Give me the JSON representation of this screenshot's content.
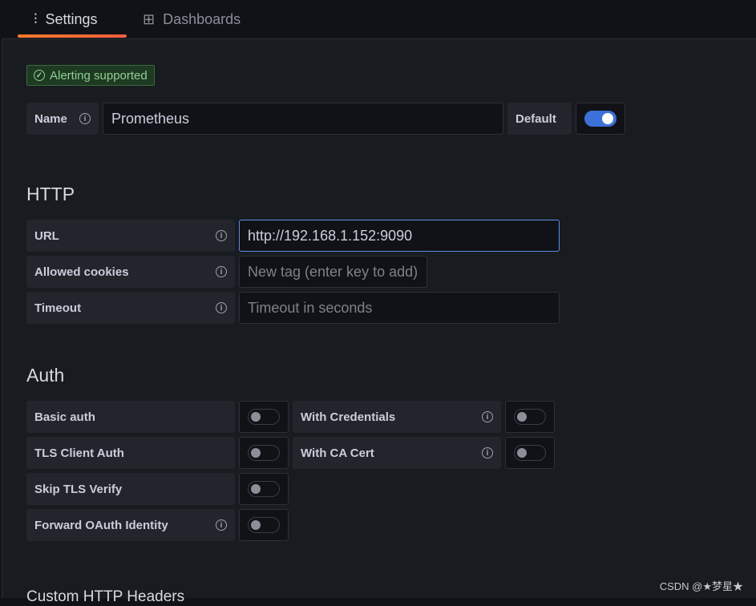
{
  "tabs": [
    {
      "label": "Settings",
      "icon": "sliders-icon",
      "active": true
    },
    {
      "label": "Dashboards",
      "icon": "grid-icon",
      "active": false
    }
  ],
  "badge": {
    "label": "Alerting supported",
    "icon": "check-circle-icon",
    "color": "#8fcf93"
  },
  "name": {
    "label": "Name",
    "value": "Prometheus",
    "default_label": "Default",
    "default_on": true
  },
  "http": {
    "title": "HTTP",
    "url_label": "URL",
    "url_value": "http://192.168.1.152:9090",
    "cookies_label": "Allowed cookies",
    "cookies_placeholder": "New tag (enter key to add)",
    "timeout_label": "Timeout",
    "timeout_placeholder": "Timeout in seconds"
  },
  "auth": {
    "title": "Auth",
    "basic": "Basic auth",
    "with_credentials": "With Credentials",
    "tls_client": "TLS Client Auth",
    "with_ca": "With CA Cert",
    "skip_tls": "Skip TLS Verify",
    "forward_oauth": "Forward OAuth Identity"
  },
  "custom_headers_title": "Custom HTTP Headers",
  "watermark": "CSDN @★梦星★",
  "accent": "#f55f3e"
}
